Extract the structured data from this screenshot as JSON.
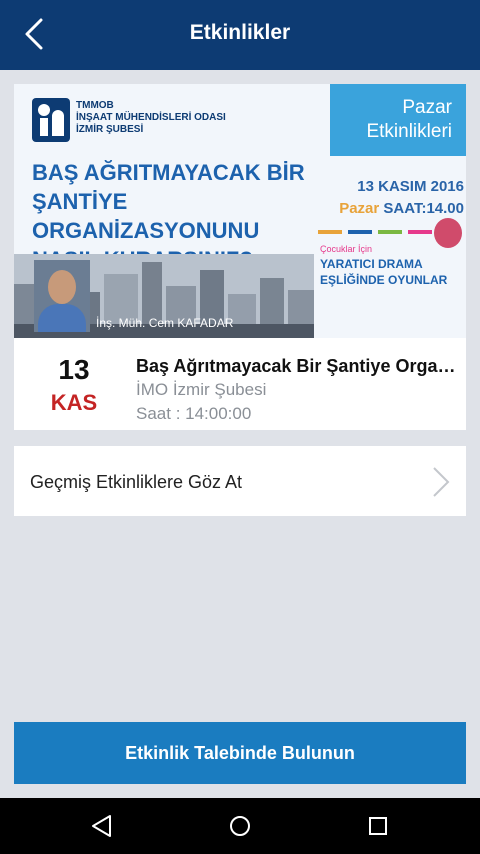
{
  "header": {
    "title": "Etkinlikler",
    "back_icon": "chevron-left-icon"
  },
  "banner": {
    "org_line1": "TMMOB",
    "org_line2": "İNŞAAT MÜHENDİSLERİ ODASI",
    "org_line3": "İZMİR ŞUBESİ",
    "tag_line1": "Pazar",
    "tag_line2": "Etkinlikleri",
    "headline_line1": "BAŞ AĞRITMAYACAK BİR",
    "headline_line2": "ŞANTİYE ORGANİZASYONUNU",
    "headline_line3": "NASIL KURARSINIZ?",
    "date_line": "13 KASIM 2016",
    "day_label": "Pazar",
    "time_label": "SAAT:14.00",
    "kids_label": "Çocuklar İçin",
    "drama_line1": "YARATICI DRAMA",
    "drama_line2": "EŞLİĞİNDE OYUNLAR",
    "speaker": "İnş. Müh. Cem KAFADAR"
  },
  "event": {
    "day": "13",
    "month": "KAS",
    "title": "Baş Ağrıtmayacak Bir Şantiye Organizasyonunu Nasıl Kurarsınız?",
    "organizer": "İMO İzmir Şubesi",
    "time": "Saat : 14:00:00"
  },
  "past_events": {
    "label": "Geçmiş Etkinliklere Göz At",
    "icon": "chevron-right-icon"
  },
  "cta": {
    "label": "Etkinlik Talebinde Bulunun"
  },
  "system_nav": {
    "back_icon": "nav-back-icon",
    "home_icon": "nav-home-icon",
    "recents_icon": "nav-recents-icon"
  },
  "colors": {
    "appbar": "#0d3b73",
    "background": "#dfe2e8",
    "cta": "#1a7cc0",
    "month_red": "#c42424"
  }
}
